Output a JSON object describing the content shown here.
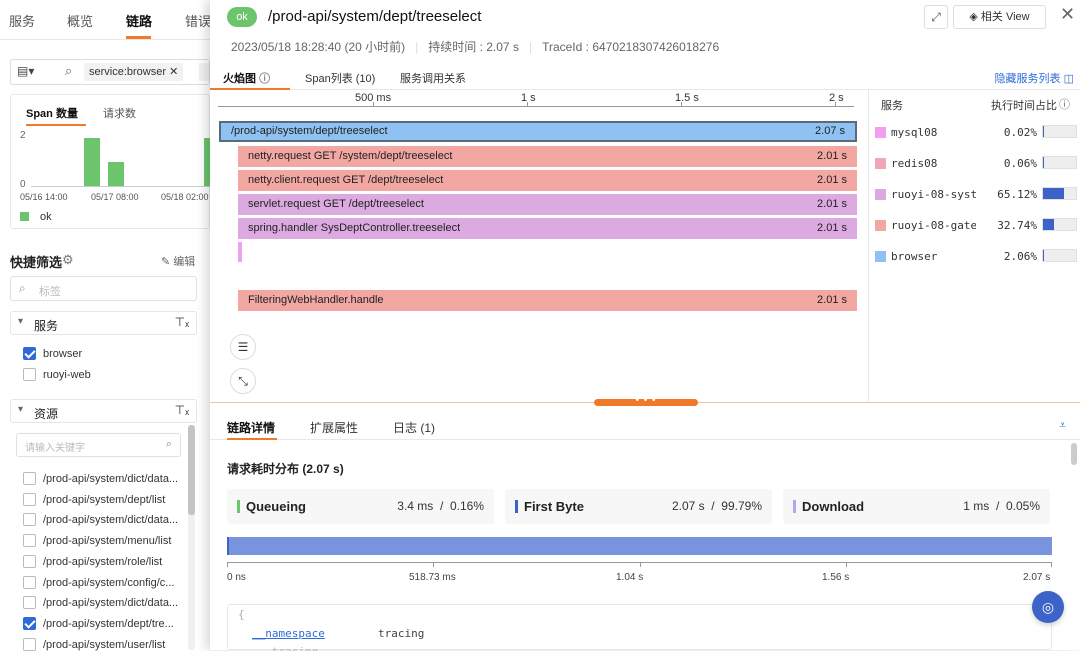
{
  "left": {
    "nav_tabs": [
      "服务",
      "概览",
      "链路",
      "错误"
    ],
    "filter_chip": "service:browser",
    "chart_tabs": [
      "Span 数量",
      "请求数"
    ],
    "chart_ticks_y": [
      "2",
      "0"
    ],
    "chart_ticks_x": [
      "05/16 14:00",
      "05/17 08:00",
      "05/18 02:00"
    ],
    "chart_values": [
      2,
      1,
      2
    ],
    "legend": "ok",
    "legend_color": "#6cc46c",
    "quick_filter": "快捷筛选",
    "edit": "编辑",
    "tag_placeholder": "标签",
    "service_group": "服务",
    "services": [
      {
        "label": "browser",
        "checked": true
      },
      {
        "label": "ruoyi-web",
        "checked": false
      }
    ],
    "resource_group": "资源",
    "keyword_placeholder": "请输入关键字",
    "resources": [
      {
        "label": "/prod-api/system/dict/data...",
        "checked": false
      },
      {
        "label": "/prod-api/system/dept/list",
        "checked": false
      },
      {
        "label": "/prod-api/system/dict/data...",
        "checked": false
      },
      {
        "label": "/prod-api/system/menu/list",
        "checked": false
      },
      {
        "label": "/prod-api/system/role/list",
        "checked": false
      },
      {
        "label": "/prod-api/system/config/c...",
        "checked": false
      },
      {
        "label": "/prod-api/system/dict/data...",
        "checked": false
      },
      {
        "label": "/prod-api/system/dept/tre...",
        "checked": true
      },
      {
        "label": "/prod-api/system/user/list",
        "checked": false
      }
    ]
  },
  "header": {
    "status": "ok",
    "title": "/prod-api/system/dept/treeselect",
    "view_label": "相关 View",
    "datetime": "2023/05/18 18:28:40 (20 小时前)",
    "duration": "持续时间 : 2.07 s",
    "trace_id": "TraceId : 6470218307426018276"
  },
  "tabs": {
    "items": [
      "火焰图",
      "Span列表 (10)",
      "服务调用关系"
    ],
    "hide_services": "隐藏服务列表"
  },
  "flame": {
    "axis": [
      "500 ms",
      "1 s",
      "1.5 s",
      "2 s"
    ],
    "spans": [
      {
        "name": "/prod-api/system/dept/treeselect",
        "dur": "2.07 s",
        "service": "browser"
      },
      {
        "name": "netty.request GET /system/dept/treeselect",
        "dur": "2.01 s",
        "service": "gate"
      },
      {
        "name": "netty.client.request GET /dept/treeselect",
        "dur": "2.01 s",
        "service": "gate"
      },
      {
        "name": "servlet.request GET /dept/treeselect",
        "dur": "2.01 s",
        "service": "sys"
      },
      {
        "name": "spring.handler SysDeptController.treeselect",
        "dur": "2.01 s",
        "service": "sys"
      },
      {
        "name": "FilteringWebHandler.handle",
        "dur": "2.01 s",
        "service": "gate"
      }
    ]
  },
  "services_panel": {
    "header_service": "服务",
    "header_pct": "执行时间占比",
    "rows": [
      {
        "name": "mysql08",
        "pct": "0.02%",
        "value": 0.0002,
        "color": "#f29ff0"
      },
      {
        "name": "redis08",
        "pct": "0.06%",
        "value": 0.0006,
        "color": "#f2a7b8"
      },
      {
        "name": "ruoyi-08-syst…",
        "pct": "65.12%",
        "value": 0.6512,
        "color": "#dca9e0"
      },
      {
        "name": "ruoyi-08-gate…",
        "pct": "32.74%",
        "value": 0.3274,
        "color": "#f2a7a3"
      },
      {
        "name": "browser",
        "pct": "2.06%",
        "value": 0.0206,
        "color": "#8fc2f2"
      }
    ]
  },
  "details": {
    "tabs": [
      "链路详情",
      "扩展属性",
      "日志 (1)"
    ],
    "title": "请求耗时分布 (2.07 s)",
    "metrics": [
      {
        "name": "Queueing",
        "value": "3.4 ms  /  0.16%",
        "color": "#6cc46c"
      },
      {
        "name": "First Byte",
        "value": "2.07 s  /  99.79%",
        "color": "#3d63c8"
      },
      {
        "name": "Download",
        "value": "1 ms  /  0.05%",
        "color": "#b9a4e8"
      }
    ],
    "timeline_ticks": [
      "0 ns",
      "518.73 ms",
      "1.04 s",
      "1.56 s",
      "2.07 s"
    ],
    "code_open": "{",
    "code_key": "__namespace",
    "code_value": "tracing",
    "code_next": "...tracing..."
  }
}
